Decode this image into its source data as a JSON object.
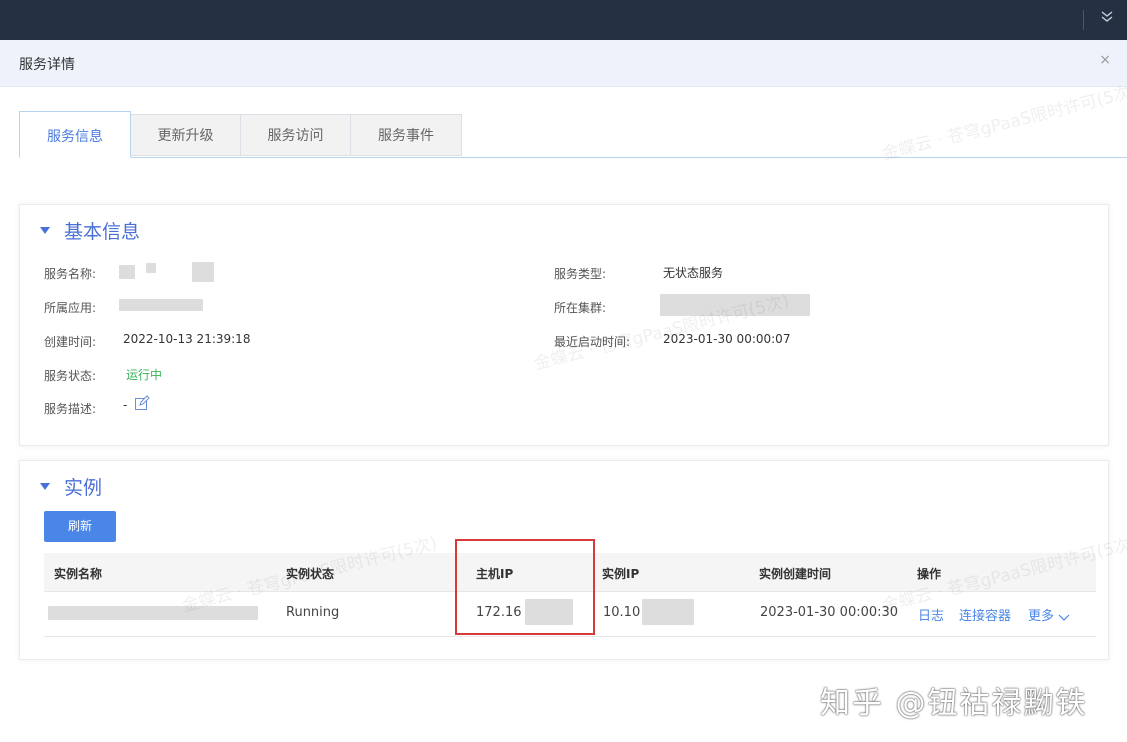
{
  "modal": {
    "title": "服务详情",
    "close_label": "×"
  },
  "tabs": [
    {
      "label": "服务信息",
      "active": true
    },
    {
      "label": "更新升级",
      "active": false
    },
    {
      "label": "服务访问",
      "active": false
    },
    {
      "label": "服务事件",
      "active": false
    }
  ],
  "basic_info": {
    "title": "基本信息",
    "service_name_label": "服务名称:",
    "app_label": "所属应用:",
    "created_label": "创建时间:",
    "created_value": "2022-10-13 21:39:18",
    "status_label": "服务状态:",
    "status_value": "运行中",
    "desc_label": "服务描述:",
    "desc_value": "-",
    "type_label": "服务类型:",
    "type_value": "无状态服务",
    "cluster_label": "所在集群:",
    "last_start_label": "最近启动时间:",
    "last_start_value": "2023-01-30 00:00:07"
  },
  "instances": {
    "title": "实例",
    "refresh_label": "刷新",
    "columns": [
      "实例名称",
      "实例状态",
      "主机IP",
      "实例IP",
      "实例创建时间",
      "操作"
    ],
    "rows": [
      {
        "status": "Running",
        "host_ip": "172.16",
        "instance_ip": "10.10",
        "created": "2023-01-30 00:00:30",
        "actions": [
          "日志",
          "连接容器",
          "更多"
        ]
      }
    ]
  },
  "watermark": "金蝶云 · 苍穹gPaaS限时许可(5次)",
  "footer_watermark": "知乎 @钮祜禄黝铁",
  "colors": {
    "accent": "#4a86e8",
    "topbar": "#243142",
    "highlight": "#d63a3a",
    "running": "#3cb35c"
  }
}
